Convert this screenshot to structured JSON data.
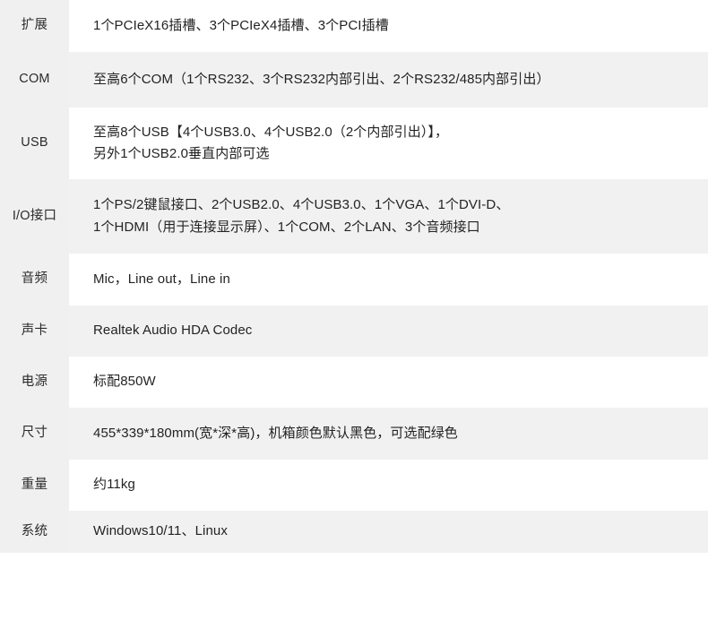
{
  "table": {
    "rows": [
      {
        "label": "扩展",
        "lines": [
          "1个PCIeX16插槽、3个PCIeX4插槽、3个PCI插槽"
        ]
      },
      {
        "label": "COM",
        "lines": [
          "至高6个COM（1个RS232、3个RS232内部引出、2个RS232/485内部引出）"
        ]
      },
      {
        "label": "USB",
        "lines": [
          "至高8个USB【4个USB3.0、4个USB2.0（2个内部引出）】，",
          "另外1个USB2.0垂直内部可选"
        ]
      },
      {
        "label": "I/O接口",
        "lines": [
          "1个PS/2键鼠接口、2个USB2.0、4个USB3.0、1个VGA、1个DVI-D、",
          "1个HDMI（用于连接显示屏）、1个COM、2个LAN、3个音频接口"
        ]
      },
      {
        "label": "音频",
        "lines": [
          "Mic，Line out，Line in"
        ]
      },
      {
        "label": "声卡",
        "lines": [
          "Realtek Audio HDA Codec"
        ]
      },
      {
        "label": "电源",
        "lines": [
          "标配850W"
        ]
      },
      {
        "label": "尺寸",
        "lines": [
          "455*339*180mm(宽*深*高)，机箱颜色默认黑色，可选配绿色"
        ]
      },
      {
        "label": "重量",
        "lines": [
          "约11kg"
        ]
      },
      {
        "label": "系统",
        "lines": [
          "Windows10/11、Linux"
        ]
      }
    ]
  },
  "colors": {
    "label_column_bg": "#f0f0f0",
    "row_alt_bg": "#f1f1f1",
    "row_bg": "#ffffff",
    "text": "#232323",
    "page_bg": "#ffffff"
  }
}
